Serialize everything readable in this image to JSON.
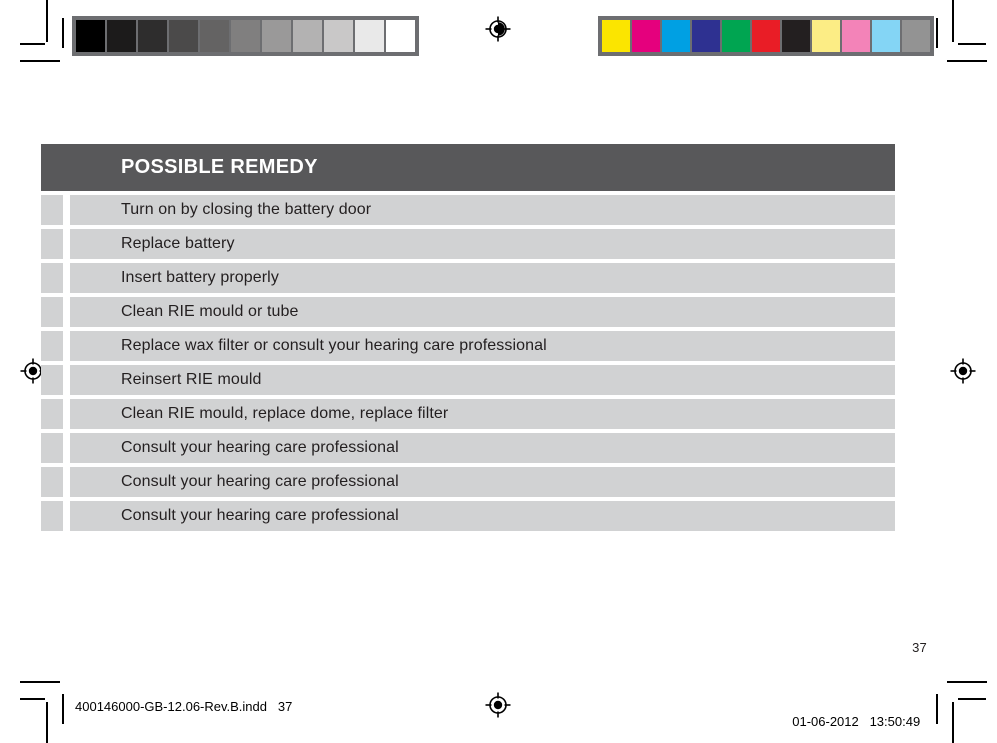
{
  "document": {
    "page_number": "37",
    "footer": {
      "filename": "400146000-GB-12.06-Rev.B.indd   37",
      "date": "01-06-2012",
      "time": "13:50:49"
    }
  },
  "table": {
    "header": {
      "label": "POSSIBLE REMEDY"
    },
    "rows": [
      {
        "remedy": "Turn on by closing the battery door"
      },
      {
        "remedy": "Replace battery"
      },
      {
        "remedy": "Insert battery properly"
      },
      {
        "remedy": "Clean RIE mould or tube"
      },
      {
        "remedy": "Replace wax filter or consult your hearing care professional"
      },
      {
        "remedy": "Reinsert RIE mould"
      },
      {
        "remedy": "Clean RIE mould, replace dome, replace filter"
      },
      {
        "remedy": "Consult your hearing care professional"
      },
      {
        "remedy": "Consult your hearing care professional"
      },
      {
        "remedy": "Consult your hearing care professional"
      }
    ]
  },
  "calibration": {
    "grayscale_strip": {
      "name": "grayscale-calibration-strip",
      "swatches": [
        "#000000",
        "#1c1b1b",
        "#2e2d2d",
        "#4b4a4a",
        "#646363",
        "#807f7f",
        "#9a9999",
        "#b3b2b2",
        "#c9c8c8",
        "#e9e9e9",
        "#ffffff"
      ]
    },
    "color_strip": {
      "name": "color-calibration-strip",
      "swatches": [
        "#fbe500",
        "#e5007d",
        "#00a0e3",
        "#2e3191",
        "#00a551",
        "#e91d26",
        "#231f20",
        "#fced85",
        "#f383b8",
        "#84d5f5",
        "#939393"
      ]
    }
  },
  "marks": {
    "registration_target": "registration-target-icon",
    "crop_mark": "crop-mark"
  }
}
